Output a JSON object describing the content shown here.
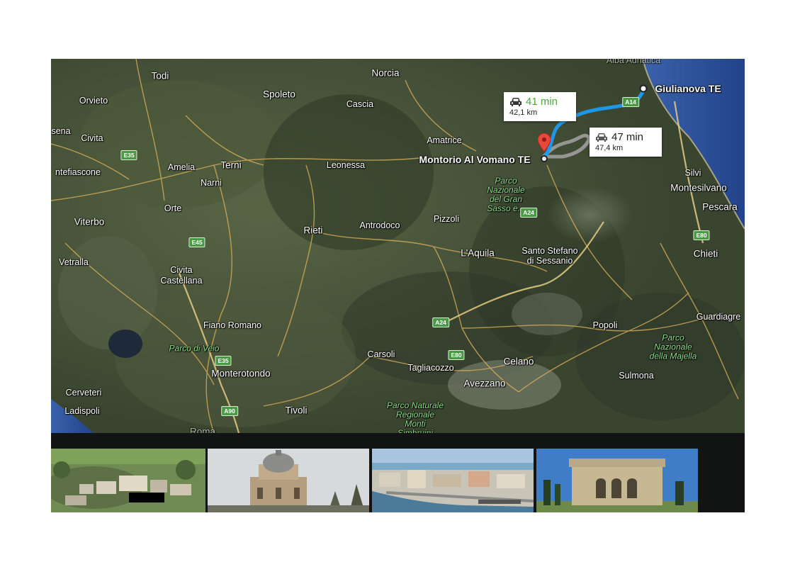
{
  "map": {
    "places": [
      {
        "key": "todi",
        "label": "Todi"
      },
      {
        "key": "norcia",
        "label": "Norcia"
      },
      {
        "key": "orvieto",
        "label": "Orvieto"
      },
      {
        "key": "spoleto",
        "label": "Spoleto"
      },
      {
        "key": "cascia",
        "label": "Cascia"
      },
      {
        "key": "sena",
        "label": "sena"
      },
      {
        "key": "civita",
        "label": "Civita"
      },
      {
        "key": "amatrice",
        "label": "Amatrice"
      },
      {
        "key": "montefiascone",
        "label": "ntefiascone"
      },
      {
        "key": "amelia",
        "label": "Amelia"
      },
      {
        "key": "terni",
        "label": "Terni"
      },
      {
        "key": "leonessa",
        "label": "Leonessa"
      },
      {
        "key": "narni",
        "label": "Narni"
      },
      {
        "key": "silvi",
        "label": "Silvi"
      },
      {
        "key": "montesilvano",
        "label": "Montesilvano"
      },
      {
        "key": "orte",
        "label": "Orte"
      },
      {
        "key": "pescara",
        "label": "Pescara"
      },
      {
        "key": "viterbo",
        "label": "Viterbo"
      },
      {
        "key": "pizzoli",
        "label": "Pizzoli"
      },
      {
        "key": "rieti",
        "label": "Rieti"
      },
      {
        "key": "antrodoco",
        "label": "Antrodoco"
      },
      {
        "key": "aquila",
        "label": "L'Aquila"
      },
      {
        "key": "santo_stefano",
        "label": "Santo Stefano\ndi Sessanio"
      },
      {
        "key": "chieti",
        "label": "Chieti"
      },
      {
        "key": "vetralla",
        "label": "Vetralla"
      },
      {
        "key": "civita_castellana",
        "label": "Civita\nCastellana"
      },
      {
        "key": "guardiagrele",
        "label": "Guardiagre"
      },
      {
        "key": "fiano_romano",
        "label": "Fiano Romano"
      },
      {
        "key": "popoli",
        "label": "Popoli"
      },
      {
        "key": "carsoli",
        "label": "Carsoli"
      },
      {
        "key": "tagliacozzo",
        "label": "Tagliacozzo"
      },
      {
        "key": "celano",
        "label": "Celano"
      },
      {
        "key": "monterotondo",
        "label": "Monterotondo"
      },
      {
        "key": "sulmona",
        "label": "Sulmona"
      },
      {
        "key": "avezzano",
        "label": "Avezzano"
      },
      {
        "key": "cerveteri",
        "label": "Cerveteri"
      },
      {
        "key": "ladispoli",
        "label": "Ladispoli"
      },
      {
        "key": "tivoli",
        "label": "Tivoli"
      },
      {
        "key": "roma",
        "label": "Roma"
      },
      {
        "key": "alba_adriatica",
        "label": "Alba Adriatica"
      }
    ],
    "parks": [
      {
        "key": "gran_sasso",
        "label": "Parco\nNazionale\ndel Gran\nSasso e..."
      },
      {
        "key": "veio",
        "label": "Parco di Veio"
      },
      {
        "key": "majella",
        "label": "Parco\nNazionale\ndella Majella"
      },
      {
        "key": "simbruini",
        "label": "Parco Naturale\nRegionale\nMonti\nSimbruini"
      }
    ],
    "shields": [
      {
        "key": "a14",
        "label": "A14"
      },
      {
        "key": "e35a",
        "label": "E35"
      },
      {
        "key": "e45",
        "label": "E45"
      },
      {
        "key": "a24a",
        "label": "A24"
      },
      {
        "key": "e80a",
        "label": "E80"
      },
      {
        "key": "a24b",
        "label": "A24"
      },
      {
        "key": "e80b",
        "label": "E80"
      },
      {
        "key": "e35b",
        "label": "E35"
      },
      {
        "key": "a90",
        "label": "A90"
      }
    ],
    "origin": "Montorio Al Vomano TE",
    "destination": "Giulianova TE",
    "routes": {
      "primary": {
        "time": "41 min",
        "distance": "42,1 km",
        "color": "#4fa83d"
      },
      "alternate": {
        "time": "47 min",
        "distance": "47,4 km",
        "color": "#222222"
      }
    },
    "colors": {
      "route_main": "#1e9bf0",
      "route_alt": "#9a9a9a",
      "pin": "#e8473b",
      "sea": "#2b4f99"
    }
  },
  "thumbnails": [
    {
      "key": "aerial_town",
      "icon": "photo-aerial-town"
    },
    {
      "key": "domed_church",
      "icon": "photo-domed-church"
    },
    {
      "key": "harbor_city",
      "icon": "photo-harbor-city"
    },
    {
      "key": "villa",
      "icon": "photo-villa"
    }
  ]
}
